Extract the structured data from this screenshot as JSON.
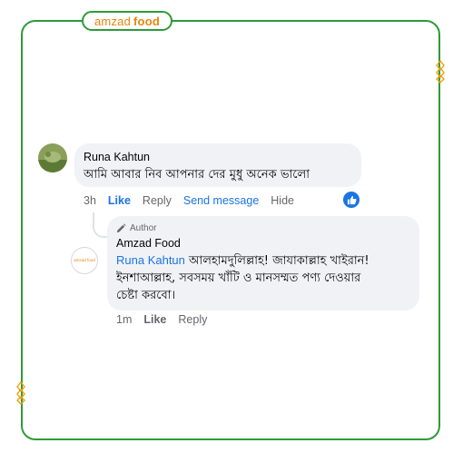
{
  "brand": {
    "part1": "amzad",
    "part2": "food",
    "color": "#e8850c",
    "frame_color": "#2e9a3a"
  },
  "comment": {
    "author": "Runa Kahtun",
    "text": "আমি আবার নিব আপনার দের মুধু অনেক ভালো",
    "time": "3h",
    "like_label": "Like",
    "reply_label": "Reply",
    "send_label": "Send message",
    "hide_label": "Hide",
    "reaction": "like-icon"
  },
  "reply": {
    "badge": "Author",
    "author": "Amzad Food",
    "mention": "Runa Kahtun",
    "line1": " আলহামদুলিল্লাহ! জাযাকাল্লাহ খাইরান!",
    "line2": "ইনশাআল্লাহ, সবসময় খাঁটি ও মানসম্মত পণ্য দেওয়ার",
    "line3": "চেষ্টা করবো।",
    "time": "1m",
    "like_label": "Like",
    "reply_label": "Reply",
    "avatar_logo": "amzad food"
  },
  "colors": {
    "link": "#1b74e4",
    "bubble": "#f0f2f5",
    "muted": "#65676b"
  }
}
